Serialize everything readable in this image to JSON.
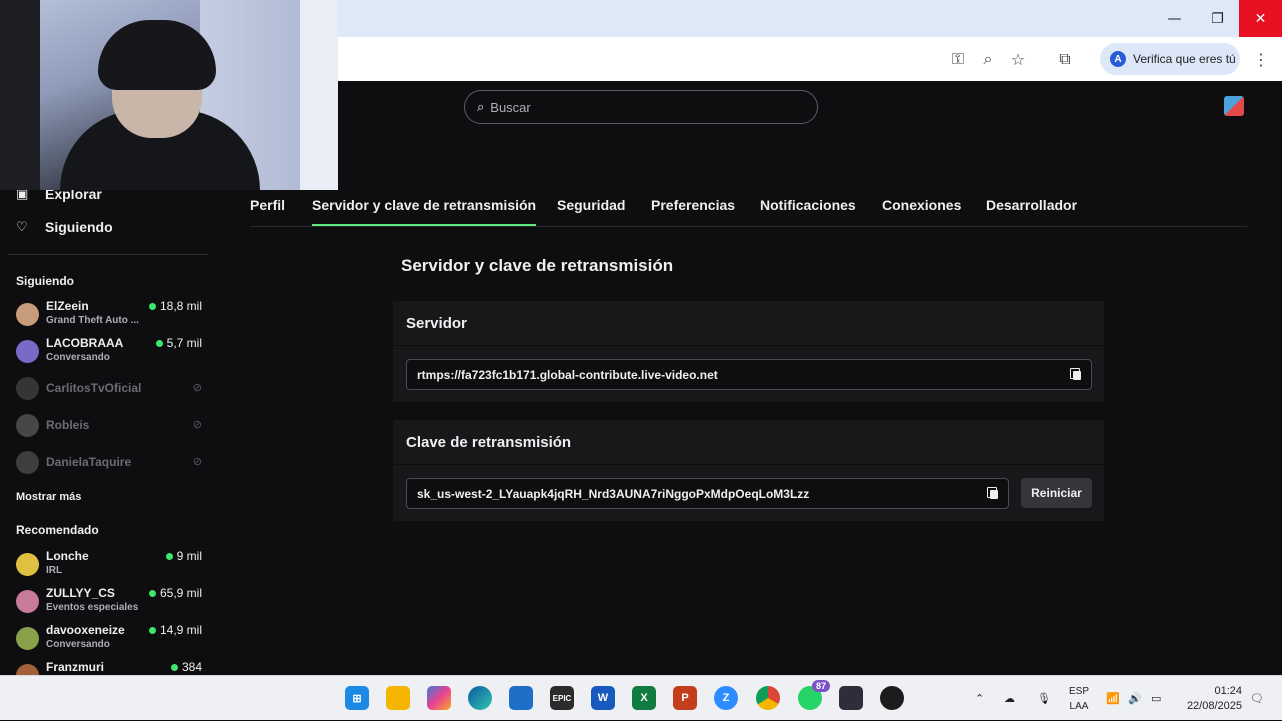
{
  "browser": {
    "verify_label": "Verifica que eres tú",
    "verify_avatar": "A",
    "minimize": "—",
    "restore": "❐",
    "close": "✕"
  },
  "search": {
    "placeholder": "Buscar"
  },
  "sidebar": {
    "nav": [
      {
        "label": "Explorar",
        "icon": "browse-icon"
      },
      {
        "label": "Siguiendo",
        "icon": "heart-icon"
      }
    ],
    "following_heading": "Siguiendo",
    "following": [
      {
        "name": "ElZeein",
        "game": "Grand Theft Auto ...",
        "viewers": "18,8 mil",
        "live": true,
        "color": "#c89c7a"
      },
      {
        "name": "LACOBRAAA",
        "game": "Conversando",
        "viewers": "5,7 mil",
        "live": true,
        "color": "#7a6ac8"
      },
      {
        "name": "CarlitosTvOficial",
        "live": false,
        "color": "#555"
      },
      {
        "name": "Robleis",
        "live": false,
        "color": "#777"
      },
      {
        "name": "DanielaTaquire",
        "live": false,
        "color": "#666"
      }
    ],
    "show_more": "Mostrar más",
    "recommended_heading": "Recomendado",
    "recommended": [
      {
        "name": "Lonche",
        "game": "IRL",
        "viewers": "9 mil",
        "color": "#e0c040"
      },
      {
        "name": "ZULLYY_CS",
        "game": "Eventos especiales",
        "viewers": "65,9 mil",
        "color": "#c87a9a"
      },
      {
        "name": "davooxeneize",
        "game": "Conversando",
        "viewers": "14,9 mil",
        "color": "#8aa04a"
      },
      {
        "name": "Franzmuri",
        "game": "",
        "viewers": "384",
        "color": "#a0603a"
      }
    ]
  },
  "tabs": [
    "Perfil",
    "Servidor y clave de retransmisión",
    "Seguridad",
    "Preferencias",
    "Notificaciones",
    "Conexiones",
    "Desarrollador"
  ],
  "main": {
    "title": "Servidor y clave de retransmisión",
    "server_heading": "Servidor",
    "server_value": "rtmps://fa723fc1b171.global-contribute.live-video.net",
    "key_heading": "Clave de retransmisión",
    "key_value": "sk_us-west-2_LYauapk4jqRH_Nrd3AUNA7riNggoPxMdpOeqLoM3Lzz",
    "reset_label": "Reiniciar"
  },
  "taskbar": {
    "whatsapp_badge": "87",
    "lang_top": "ESP",
    "lang_bottom": "LAA",
    "time": "01:24",
    "date": "22/08/2025",
    "apps": [
      "windows-start-icon",
      "file-explorer-icon",
      "copilot-icon",
      "edge-icon",
      "store-icon",
      "epic-games-icon",
      "word-icon",
      "excel-icon",
      "powerpoint-icon",
      "zoom-icon",
      "chrome-icon",
      "whatsapp-icon",
      "terminal-icon",
      "obs-icon"
    ]
  }
}
